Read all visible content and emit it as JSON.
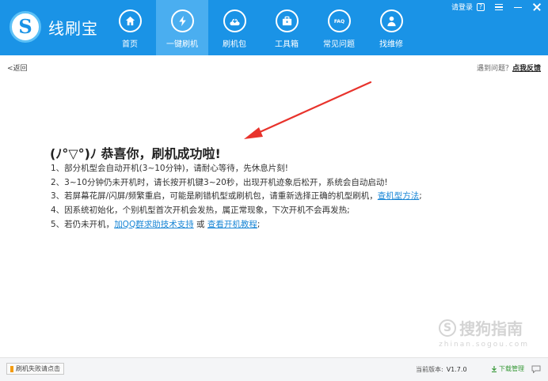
{
  "app": {
    "name": "线刷宝",
    "logo_glyph": "S",
    "accent": "#1a93e6",
    "active_tab_color": "#4aaef0"
  },
  "topbar": {
    "login": "请登录",
    "help_badge": "?"
  },
  "nav": {
    "items": [
      {
        "label": "首页",
        "icon": "home-icon"
      },
      {
        "label": "一键刷机",
        "icon": "lightning-icon",
        "active": true
      },
      {
        "label": "刷机包",
        "icon": "package-icon"
      },
      {
        "label": "工具箱",
        "icon": "toolbox-icon"
      },
      {
        "label": "常见问题",
        "icon": "faq-icon",
        "icon_text": "FAQ"
      },
      {
        "label": "找维修",
        "icon": "repair-person-icon"
      }
    ]
  },
  "subbar": {
    "back": "<返回",
    "problem_prefix": "遇到问题？",
    "feedback": "点我反馈"
  },
  "content": {
    "title": "(ﾉ°▽°)ﾉ 恭喜你，刷机成功啦!",
    "line1": "1、部分机型会自动开机(3~10分钟)，请耐心等待，先休息片刻!",
    "line2": "2、3~10分钟仍未开机时，请长按开机键3~20秒，出现开机迹象后松开，系统会自动启动!",
    "line3_text": "3、若屏幕花屏/闪屏/频繁重启，可能是刷错机型或刷机包，请重新选择正确的机型刷机，",
    "line3_link": "查机型方法",
    "line3_end": ";",
    "line4": "4、因系统初始化，个别机型首次开机会发热，属正常现象，下次开机不会再发热;",
    "line5_text": "5、若仍未开机，",
    "line5_link1": "加QQ群求助技术支持",
    "line5_or": " 或 ",
    "line5_link2": "查看开机教程",
    "line5_end": ";"
  },
  "watermark": {
    "glyph": "S",
    "text": "搜狗指南",
    "url": "zhinan.sogou.com"
  },
  "footer": {
    "fail_button": "刷机失败请点击",
    "version_label": "当前版本:",
    "version_value": "V1.7.0",
    "download": "下载管理"
  }
}
